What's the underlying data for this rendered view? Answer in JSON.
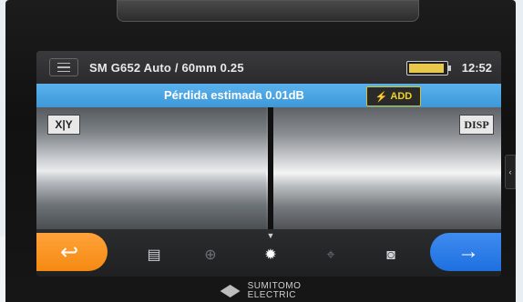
{
  "status_bar": {
    "program": "SM G652 Auto / 60mm 0.25",
    "time": "12:52"
  },
  "loss_bar": {
    "text": "Pérdida estimada  0.01dB",
    "add_label": "ADD"
  },
  "view": {
    "xy_label": "X|Y",
    "disp_label": "DISP"
  },
  "toolbar": {
    "back_symbol": "↩",
    "next_symbol": "→"
  },
  "brand": {
    "line1": "SUMITOMO",
    "line2": "ELECTRIC"
  },
  "colors": {
    "loss_bar": "#4aa6e6",
    "back_button": "#f58a12",
    "next_button": "#1e6fe0",
    "add_badge_text": "#f0d21e"
  }
}
